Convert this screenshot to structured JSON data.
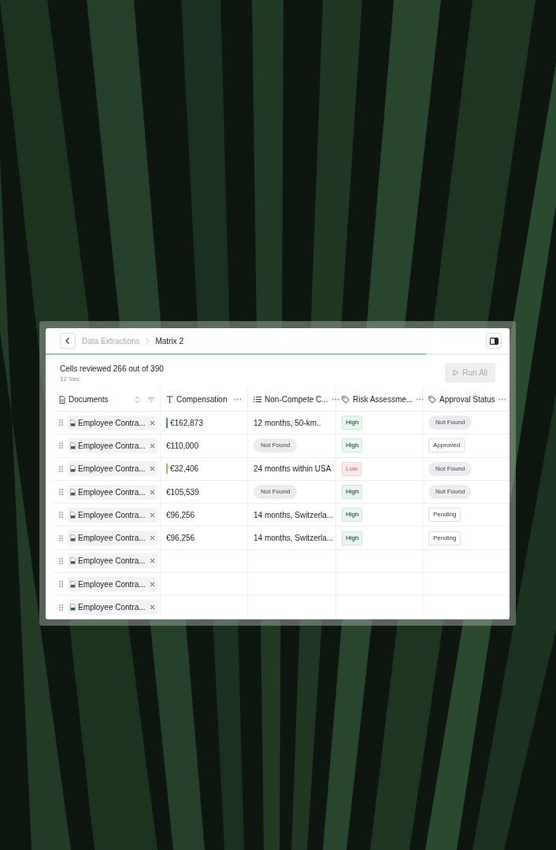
{
  "breadcrumb": {
    "items": [
      {
        "label": "Data Extractions",
        "selected": false
      },
      {
        "label": "Matrix 2",
        "selected": true
      }
    ]
  },
  "progress": {
    "level": 0.82
  },
  "summary": {
    "text": "Cells reviewed 266 out of 390",
    "elapsed": "12 Sec"
  },
  "run_button": {
    "label": "Run All",
    "disabled": true
  },
  "table": {
    "columns": [
      {
        "label": "Documents",
        "kind": "document"
      },
      {
        "label": "Compensation",
        "kind": "text"
      },
      {
        "label": "Non-Compete C...",
        "kind": "list"
      },
      {
        "label": "Risk Assessme...",
        "kind": "tag"
      },
      {
        "label": "Approval Status",
        "kind": "tag"
      }
    ],
    "rows": [
      {
        "document": "Employee Contra...",
        "compensation": {
          "text": "€162,873",
          "color": "#4a7fe0"
        },
        "non_compete": {
          "text": "12 months, 50-km..",
          "kind": "plain"
        },
        "risk": {
          "text": "High",
          "kind": "positive"
        },
        "approval": {
          "text": "Not Found",
          "kind": "pill"
        }
      },
      {
        "document": "Employee Contra...",
        "compensation": {
          "text": "€110,000"
        },
        "non_compete": {
          "text": "Not Found",
          "kind": "pill"
        },
        "risk": {
          "text": "High",
          "kind": "positive"
        },
        "approval": {
          "text": "Approved",
          "kind": "outline"
        }
      },
      {
        "document": "Employee Contra...",
        "compensation": {
          "text": "€32,406",
          "color": "#e0a050"
        },
        "non_compete": {
          "text": "24 months within USA",
          "kind": "plain"
        },
        "risk": {
          "text": "Low",
          "kind": "negative"
        },
        "approval": {
          "text": "Not Found",
          "kind": "pill"
        }
      },
      {
        "document": "Employee Contra...",
        "compensation": {
          "text": "€105,539"
        },
        "non_compete": {
          "text": "Not Found",
          "kind": "pill"
        },
        "risk": {
          "text": "High",
          "kind": "positive"
        },
        "approval": {
          "text": "Not Found",
          "kind": "pill"
        }
      },
      {
        "document": "Employee Contra...",
        "compensation": {
          "text": "€96,256"
        },
        "non_compete": {
          "text": "14 months, Switzerla...",
          "kind": "plain"
        },
        "risk": {
          "text": "High",
          "kind": "positive"
        },
        "approval": {
          "text": "Pending",
          "kind": "outline"
        }
      },
      {
        "document": "Employee Contra...",
        "compensation": {
          "text": "€96,256"
        },
        "non_compete": {
          "text": "14 months, Switzerla...",
          "kind": "plain"
        },
        "risk": {
          "text": "High",
          "kind": "positive"
        },
        "approval": {
          "text": "Pending",
          "kind": "outline"
        }
      },
      {
        "document": "Employee Contra..."
      },
      {
        "document": "Employee Contra..."
      },
      {
        "document": "Employee Contra..."
      }
    ]
  }
}
